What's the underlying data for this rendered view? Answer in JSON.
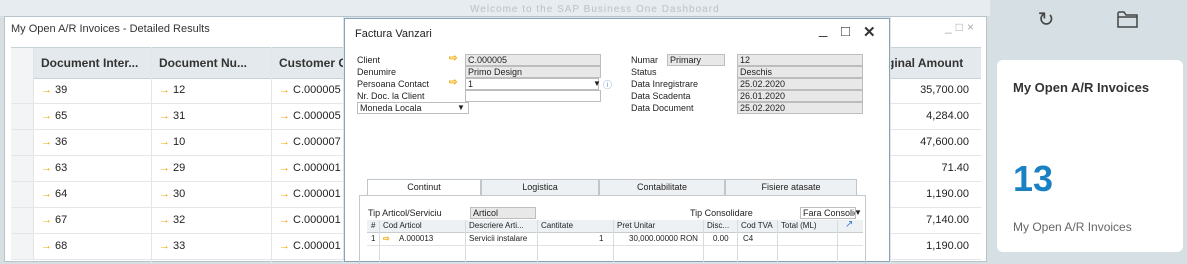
{
  "background": {
    "faded_text": "Welcome to the SAP Business One Dashboard"
  },
  "right_panel": {
    "kpi": {
      "title": "My Open A/R Invoices",
      "value": "13",
      "subtitle": "My Open A/R Invoices",
      "accent": "#1a82c4"
    }
  },
  "ar_window": {
    "title": "My Open A/R Invoices - Detailed Results",
    "columns": [
      "Document Inter...",
      "Document Nu...",
      "Customer C",
      "ginal Amount"
    ],
    "rows": [
      {
        "internal": "39",
        "number": "12",
        "customer": "C.000005",
        "amount": "35,700.00"
      },
      {
        "internal": "65",
        "number": "31",
        "customer": "C.000005",
        "amount": "4,284.00"
      },
      {
        "internal": "36",
        "number": "10",
        "customer": "C.000007",
        "amount": "47,600.00"
      },
      {
        "internal": "63",
        "number": "29",
        "customer": "C.000001",
        "amount": "71.40"
      },
      {
        "internal": "64",
        "number": "30",
        "customer": "C.000001",
        "amount": "1,190.00"
      },
      {
        "internal": "67",
        "number": "32",
        "customer": "C.000001",
        "amount": "7,140.00"
      },
      {
        "internal": "68",
        "number": "33",
        "customer": "C.000001",
        "amount": "1,190.00"
      }
    ]
  },
  "invoice": {
    "title": "Factura Vanzari",
    "labels": {
      "client": "Client",
      "denumire": "Denumire",
      "contact": "Persoana Contact",
      "nr_doc": "Nr. Doc. la Client",
      "currency": "Moneda Locala",
      "numar": "Numar",
      "status": "Status",
      "data_inreg": "Data Inregistrare",
      "data_scad": "Data Scadenta",
      "data_doc": "Data Document"
    },
    "values": {
      "client": "C.000005",
      "denumire": "Primo Design",
      "contact": "1",
      "nr_doc": "",
      "series": "Primary",
      "numar": "12",
      "status": "Deschis",
      "data_inreg": "25.02.2020",
      "data_scad": "26.01.2020",
      "data_doc": "25.02.2020"
    },
    "tabs": [
      "Continut",
      "Logistica",
      "Contabilitate",
      "Fisiere atasate"
    ],
    "item_type_label": "Tip Articol/Serviciu",
    "item_type_value": "Articol",
    "tax_type_label": "Tip Consolidare",
    "tax_type_value": "Fara Consolida",
    "line_columns": [
      "#",
      "Cod Articol",
      "Descriere Arti...",
      "Cantitate",
      "Pret Unitar",
      "Disc...",
      "Cod TVA",
      "Total (ML)"
    ],
    "line": {
      "n": "1",
      "code": "A.000013",
      "desc": "Servicii instalare",
      "qty": "1",
      "price": "30,000.00000 RON",
      "disc": "0.00",
      "vat": "C4",
      "total": ""
    }
  }
}
